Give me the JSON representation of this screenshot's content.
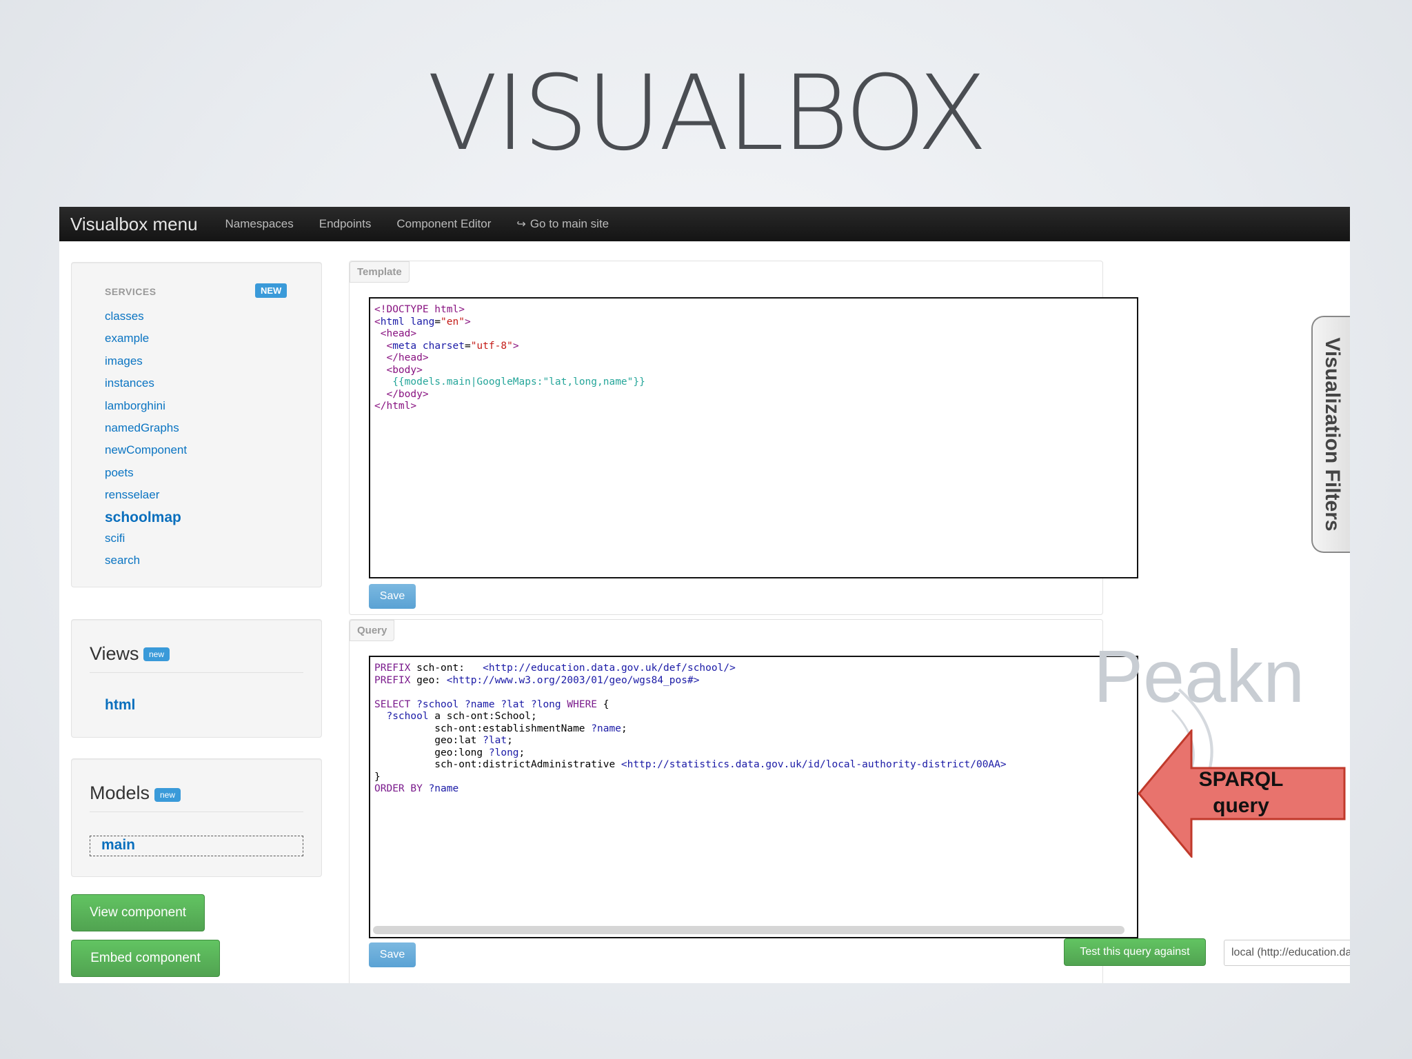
{
  "slide": {
    "title": "VISUALBOX"
  },
  "navbar": {
    "brand": "Visualbox menu",
    "links": [
      "Namespaces",
      "Endpoints",
      "Component Editor",
      "Go to main site"
    ]
  },
  "services": {
    "header": "SERVICES",
    "badge": "NEW",
    "items": [
      "classes",
      "example",
      "images",
      "instances",
      "lamborghini",
      "namedGraphs",
      "newComponent",
      "poets",
      "rensselaer",
      "schoolmap",
      "scifi",
      "search"
    ],
    "active": "schoolmap"
  },
  "views": {
    "title": "Views",
    "badge": "new",
    "items": [
      "html"
    ]
  },
  "models": {
    "title": "Models",
    "badge": "new",
    "items": [
      "main"
    ]
  },
  "buttons": {
    "view_component": "View component",
    "embed_component": "Embed component"
  },
  "template_panel": {
    "label": "Template",
    "save": "Save"
  },
  "query_panel": {
    "label": "Query",
    "save": "Save",
    "test_button": "Test this query against",
    "endpoint_select": "local (http://education.data.gov.uk"
  },
  "visualization_filters": "Visualization Filters",
  "annotation": {
    "line1": "SPARQL",
    "line2": "query"
  },
  "watermark": "Peakn",
  "colors": {
    "navbar": "#1b1b1b",
    "link": "#0a74c2",
    "green_button": "#5bb75b",
    "annotation_arrow": "#e8706c"
  }
}
